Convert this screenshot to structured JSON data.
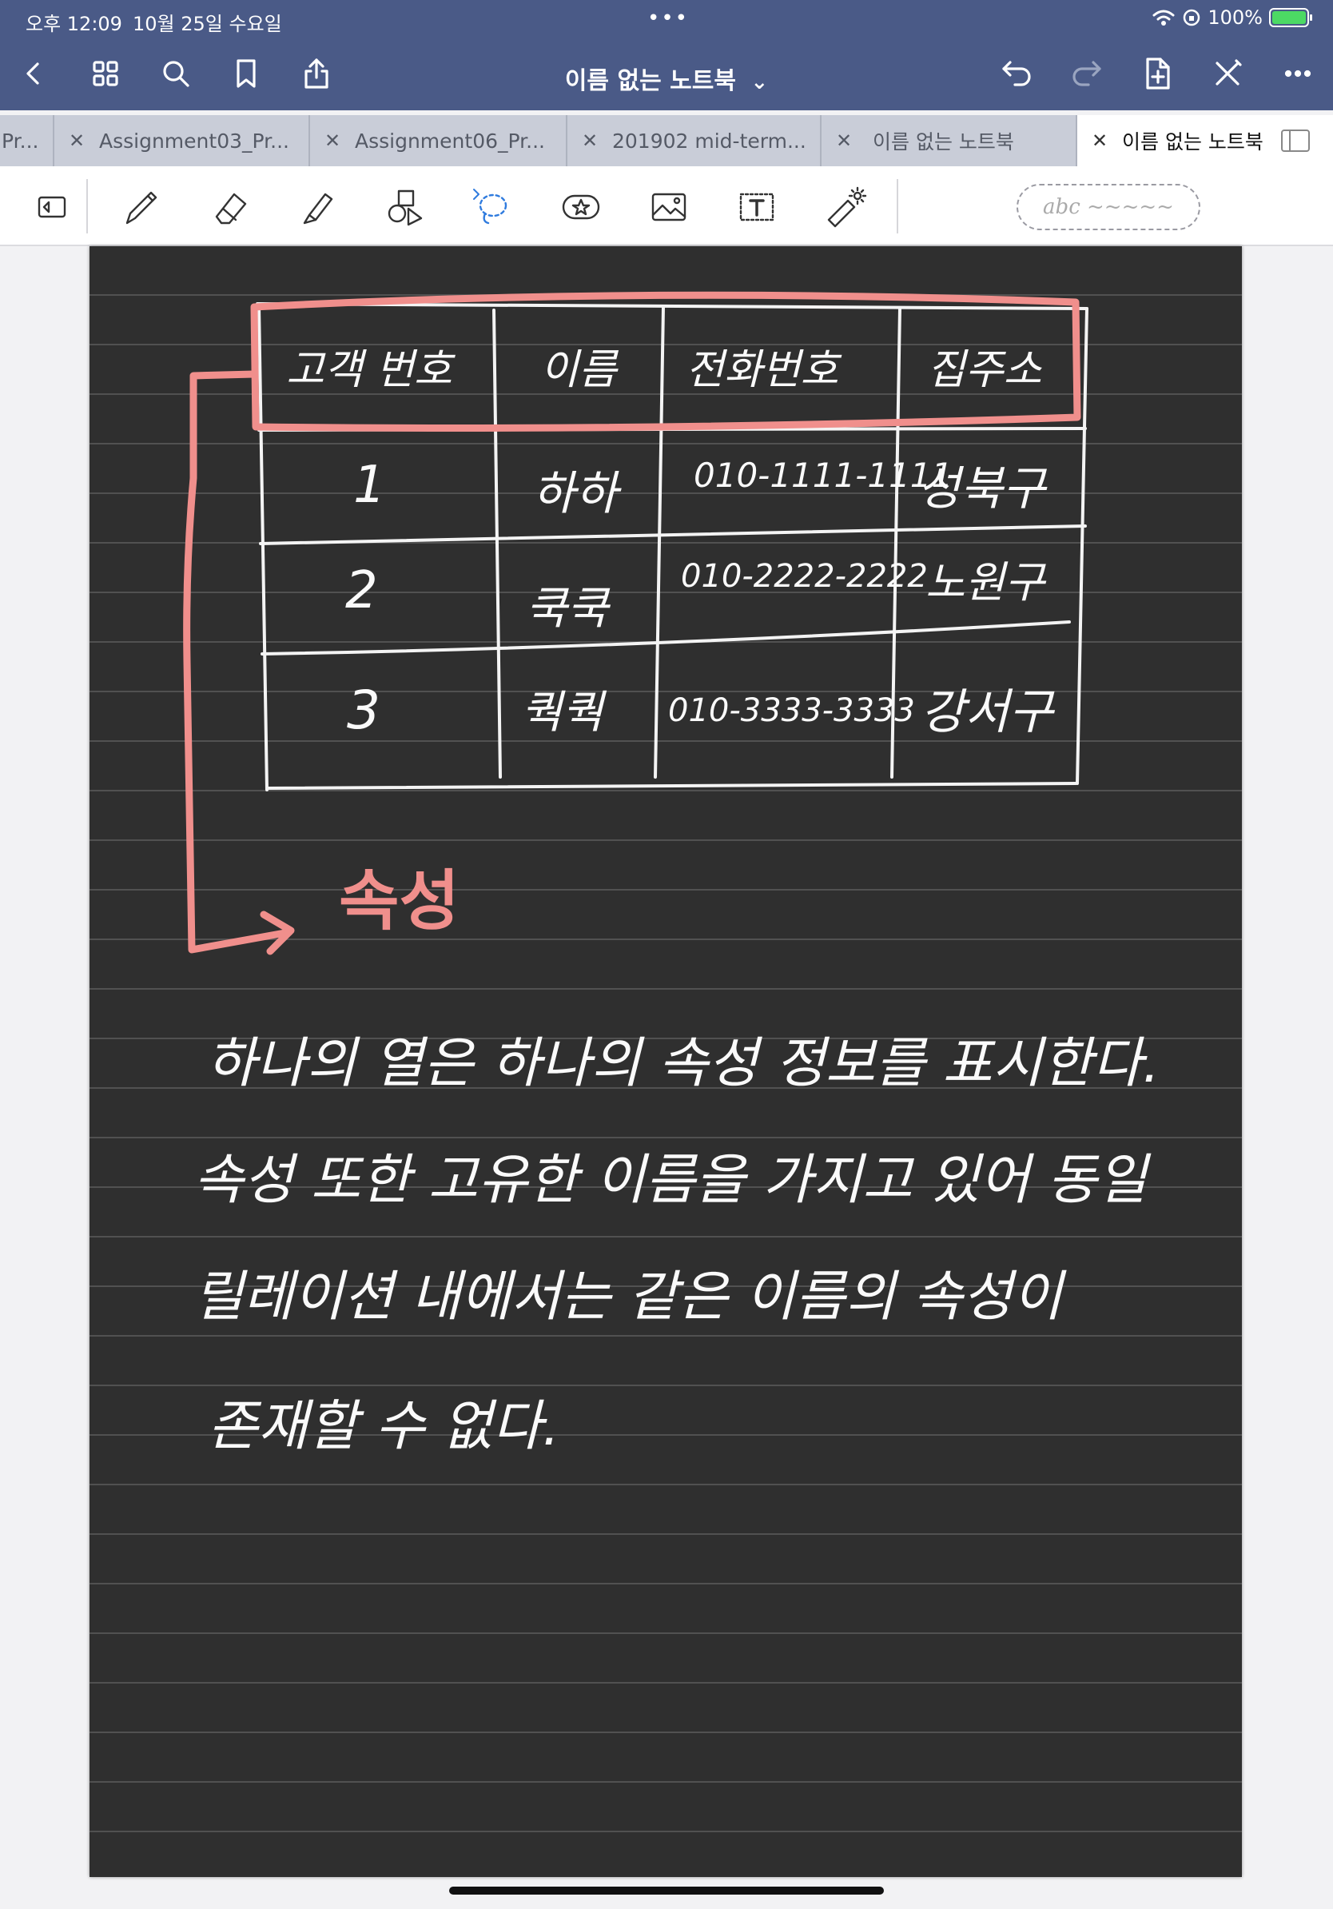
{
  "status": {
    "time": "오후 12:09",
    "date": "10월 25일 수요일",
    "battery": "100%"
  },
  "navbar": {
    "title": "이름 없는 노트북",
    "title_chevron": "⌄"
  },
  "tabs": [
    {
      "label": "Pr..."
    },
    {
      "label": "Assignment03_Pr..."
    },
    {
      "label": "Assignment06_Pr..."
    },
    {
      "label": "201902 mid-term..."
    },
    {
      "label": "이름 없는 노트북"
    },
    {
      "label": "이름 없는 노트북",
      "active": true
    }
  ],
  "toolbar": {
    "abc_placeholder": "abc ~~~~~"
  },
  "note": {
    "table": {
      "headers": [
        "고객 번호",
        "이름",
        "전화번호",
        "집주소"
      ],
      "rows": [
        [
          "1",
          "하하",
          "010-1111-1111",
          "성북구"
        ],
        [
          "2",
          "쿡쿡",
          "010-2222-2222",
          "노원구"
        ],
        [
          "3",
          "쿽쿽",
          "010-3333-3333",
          "강서구"
        ]
      ]
    },
    "annotation": "속성",
    "lines": [
      "하나의 열은 하나의 속성 정보를 표시한다.",
      "속성 또한 고유한 이름을 가지고 있어 동일",
      "릴레이션 내에서는 같은 이름의 속성이",
      "존재할 수 없다."
    ]
  }
}
